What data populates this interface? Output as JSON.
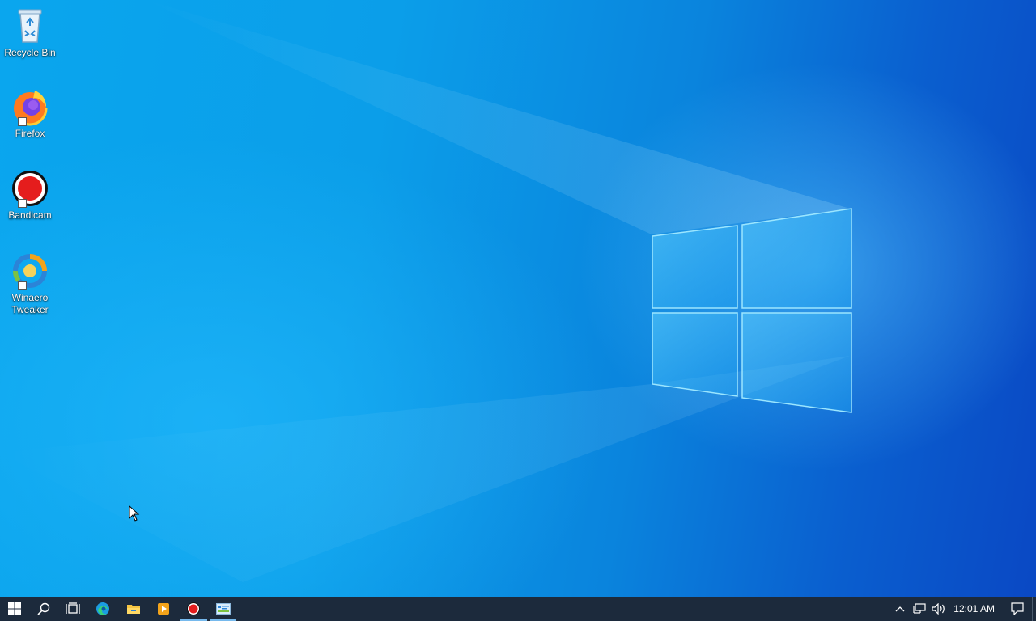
{
  "desktop": {
    "icons": [
      {
        "label": "Recycle Bin",
        "icon": "recycle-bin-icon"
      },
      {
        "label": "Firefox",
        "icon": "firefox-icon"
      },
      {
        "label": "Bandicam",
        "icon": "bandicam-icon"
      },
      {
        "label": "Winaero Tweaker",
        "icon": "winaero-tweaker-icon"
      }
    ]
  },
  "taskbar": {
    "buttons": [
      {
        "icon": "start-icon"
      },
      {
        "icon": "search-icon"
      },
      {
        "icon": "task-view-icon"
      },
      {
        "icon": "edge-icon"
      },
      {
        "icon": "file-explorer-icon"
      },
      {
        "icon": "media-player-icon"
      },
      {
        "icon": "bandicam-icon",
        "active": true
      },
      {
        "icon": "winaero-tweaker-icon",
        "active": true
      }
    ],
    "tray": {
      "icons": [
        "chevron-up-icon",
        "network-icon",
        "volume-icon"
      ],
      "clock": "12:01 AM",
      "notification_icon": "action-center-icon"
    },
    "background_color": "#1c2a3c",
    "accent_color": "#76b9ed"
  }
}
